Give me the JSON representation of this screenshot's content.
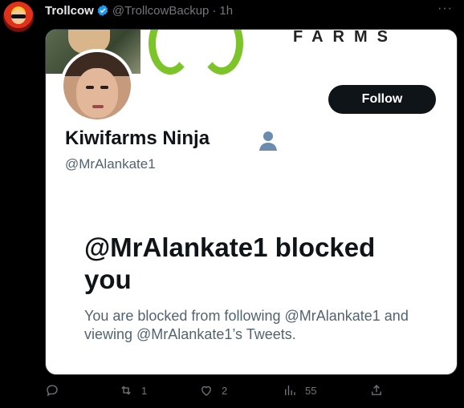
{
  "tweet": {
    "author_name": "Trollcow",
    "author_handle": "@TrollcowBackup",
    "separator": "·",
    "time": "1h",
    "more": "···"
  },
  "card": {
    "banner_text": "FARMS",
    "follow_label": "Follow",
    "profile_name": "Kiwifarms Ninja",
    "profile_handle": "@MrAlankate1",
    "blocked_title": "@MrAlankate1 blocked you",
    "blocked_description": "You are blocked from following @MrAlankate1 and viewing @MrAlankate1’s Tweets."
  },
  "actions": {
    "replies": "",
    "retweets": "1",
    "likes": "2",
    "views": "55"
  },
  "colors": {
    "background": "#000000",
    "verified": "#1d9bf0",
    "follow_button": "#0f1419",
    "leaf_green": "#7cc42a"
  },
  "icons": [
    "verified-badge-icon",
    "more-icon",
    "person-icon",
    "reply-icon",
    "retweet-icon",
    "like-icon",
    "views-icon",
    "share-icon"
  ]
}
